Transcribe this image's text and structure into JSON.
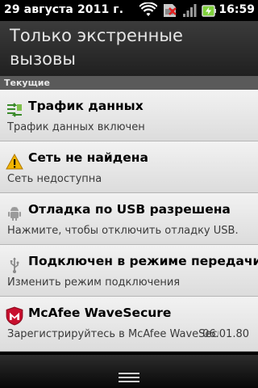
{
  "status_bar": {
    "date": "29 августа 2011 г.",
    "time": "16:59",
    "icons": [
      "wifi-icon",
      "no-sim-icon",
      "signal-icon",
      "battery-charging-icon"
    ]
  },
  "header": {
    "title": "Только экстренные вызовы"
  },
  "section": {
    "label": "Текущие"
  },
  "notifications": [
    {
      "icon": "data-traffic-icon",
      "title": "Трафик данных",
      "subtitle": "Трафик данных включен",
      "extra": ""
    },
    {
      "icon": "warning-icon",
      "title": "Сеть не найдена",
      "subtitle": "Сеть недоступна",
      "extra": ""
    },
    {
      "icon": "android-usb-icon",
      "title": "Отладка по USB разрешена",
      "subtitle": "Нажмите, чтобы отключить отладку USB.",
      "extra": ""
    },
    {
      "icon": "usb-icon",
      "title": "Подключен в режиме передачи",
      "subtitle": "Изменить режим подключения",
      "extra": ""
    },
    {
      "icon": "mcafee-icon",
      "title": "McAfee WaveSecure",
      "subtitle": "Зарегистрируйтесь в McAfee WaveSecure",
      "extra": "06.01.80"
    }
  ],
  "colors": {
    "status_bar_bg": "#000000",
    "header_bg": "#2f2f2f",
    "section_bg": "#5a5a5a",
    "item_bg": "#e8e8e8",
    "warning": "#f0b400",
    "mcafee_red": "#c8102e",
    "battery_green": "#7fd13b"
  }
}
